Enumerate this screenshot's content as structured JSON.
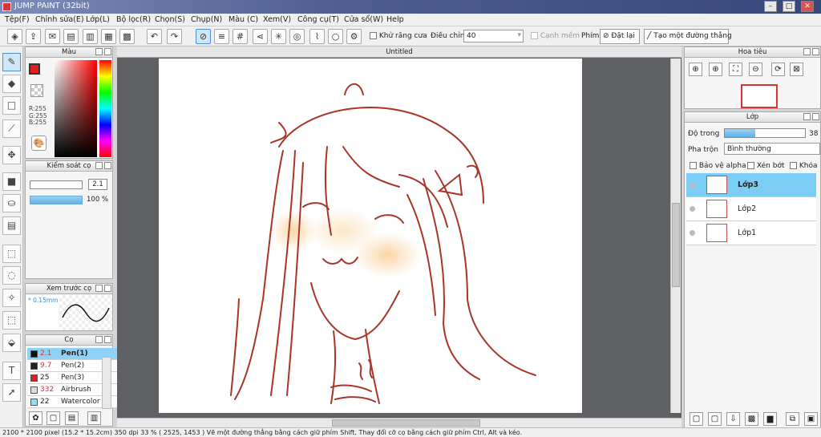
{
  "app": {
    "title": "JUMP PAINT (32bit)"
  },
  "menu": [
    "Tệp(F)",
    "Chỉnh sửa(E)",
    "Lớp(L)",
    "Bộ lọc(R)",
    "Chọn(S)",
    "Chụp(N)",
    "Màu (C)",
    "Xem(V)",
    "Công cụ(T)",
    "Cửa sổ(W)",
    "Help"
  ],
  "toolbar": {
    "antialias_label": "Khử răng cưa",
    "adjust_label": "Điều chỉnh",
    "adjust_value": "40",
    "smooth_label": "Cạnh mềm",
    "keys_label": "Phím",
    "reset_label": "Đặt lại",
    "line_label": "Tạo một đường thẳng"
  },
  "color_panel": {
    "title": "Màu",
    "r": "R:255",
    "g": "G:255",
    "b": "B:255",
    "primary": "#e02020",
    "secondary": "#ffffff"
  },
  "brush_control": {
    "title": "Kiểm soát cọ",
    "size": "2.1",
    "opacity": "100 %"
  },
  "brush_preview": {
    "title": "Xem trước cọ",
    "size": "0.15mm"
  },
  "brushes": {
    "title": "Cọ",
    "items": [
      {
        "size": "2.1",
        "name": "Pen(1)",
        "color": "#111111",
        "selected": true
      },
      {
        "size": "9.7",
        "name": "Pen(2)",
        "color": "#222222",
        "selected": false
      },
      {
        "size": "25",
        "name": "Pen(3)",
        "color": "#e02020",
        "selected": false
      },
      {
        "size": "332",
        "name": "Airbrush",
        "color": "#dddddd",
        "selected": false
      },
      {
        "size": "22",
        "name": "Watercolor (",
        "color": "#8fe0f0",
        "selected": false
      }
    ]
  },
  "canvas": {
    "tab": "Untitled"
  },
  "navigator": {
    "title": "Hoa tiêu"
  },
  "layers": {
    "title": "Lớp",
    "opacity_label": "Độ trong",
    "opacity_value": "38 %",
    "opacity_fraction": 0.38,
    "blend_label": "Pha trộn",
    "blend_value": "Bình thường",
    "protect_alpha": "Bảo vệ alpha",
    "clip": "Xén bớt",
    "lock": "Khóa",
    "items": [
      {
        "name": "Lớp3",
        "selected": true
      },
      {
        "name": "Lớp2",
        "selected": false
      },
      {
        "name": "Lớp1",
        "selected": false
      }
    ]
  },
  "status": {
    "text": "2100 * 2100 pixel   (15.2 * 15.2cm)   350 dpi   33 %   ( 2525, 1453 )   Vẽ một đường thẳng bằng cách giữ phím Shift. Thay đổi cỡ cọ bằng cách giữ phím Ctrl, Alt và kéo."
  }
}
